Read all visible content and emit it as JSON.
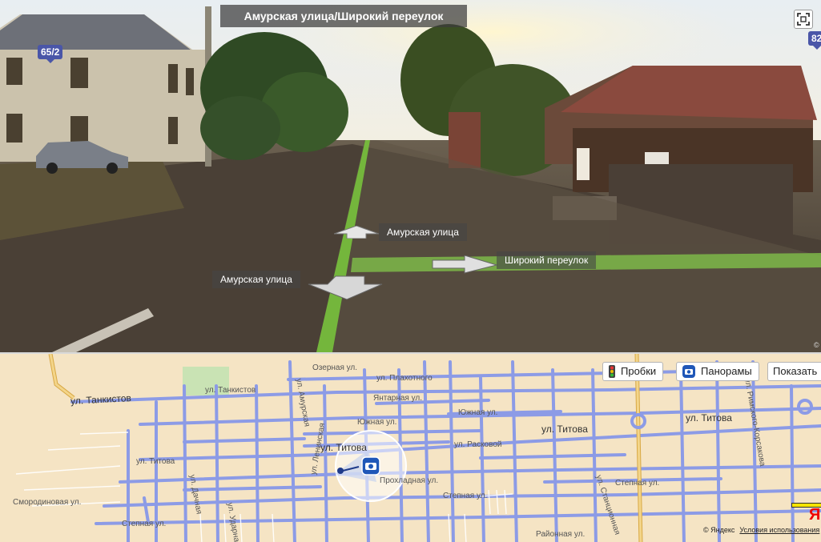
{
  "panorama": {
    "title": "Амурская улица/Широкий переулок",
    "badges": {
      "left": "65/2",
      "right": "82"
    },
    "arrows": {
      "forward": "Амурская улица",
      "back": "Амурская улица",
      "right": "Широкий переулок"
    },
    "copyright": "©"
  },
  "map": {
    "buttons": {
      "traffic": "Пробки",
      "panoramas": "Панорамы",
      "show": "Показать"
    },
    "streets": {
      "tankistov_big": "ул. Танкистов",
      "tankistov": "ул. Танкистов",
      "ozernaya": "Озерная ул.",
      "plakhotnogo": "ул. Плахотного",
      "yantarnaya": "Янтарная ул.",
      "yuzhnaya1": "Южная ул.",
      "yuzhnaya2": "Южная ул.",
      "titova_big": "ул. Титова",
      "titova_center": "ул. Титова",
      "titova_right": "ул. Титова",
      "titova_left": "ул. Титова",
      "raskovoy": "ул. Расковой",
      "prokhladnaya": "Прохладная ул.",
      "smorodinovaya": "Смородиновая ул.",
      "stepnaya_left": "Степная ул.",
      "stepnaya_mid": "Степная ул.",
      "stepnaya_right": "Степная ул.",
      "rayonnaya": "Районная ул.",
      "rimskogo": "ул. Римского-Корсакова",
      "kolkhoznaya": "ул. Станционная",
      "vertical_a": "ул. Дачная",
      "vertical_b": "ул. Ударная",
      "vertical_c": "ул. Амурская",
      "vertical_d": "ул. Ленинская"
    },
    "footer": {
      "copyright": "© Яндекс",
      "terms": "Условия использования"
    },
    "logo": "Я"
  },
  "colors": {
    "road": "#8c9be6",
    "main_road": "#e6b85c",
    "land": "#f5e4c4",
    "title_bg": "#3c3c3c"
  }
}
